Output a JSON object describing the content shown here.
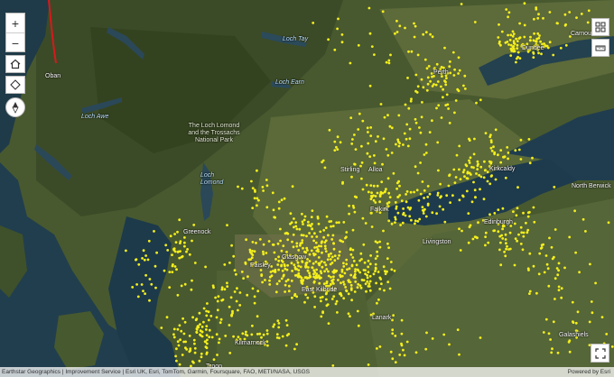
{
  "map": {
    "place_labels": [
      {
        "id": "oban",
        "text": "Oban"
      },
      {
        "id": "perth",
        "text": "Perth"
      },
      {
        "id": "dundee",
        "text": "Dundee"
      },
      {
        "id": "carnoustie",
        "text": "Carnous"
      },
      {
        "id": "kirkcaldy",
        "text": "Kirkcaldy"
      },
      {
        "id": "stirling",
        "text": "Stirling"
      },
      {
        "id": "alloa",
        "text": "Alloa"
      },
      {
        "id": "falkirk",
        "text": "Falkirk"
      },
      {
        "id": "north-berwick",
        "text": "North Berwick"
      },
      {
        "id": "edinburgh",
        "text": "Edinburgh"
      },
      {
        "id": "livingston",
        "text": "Livingston"
      },
      {
        "id": "greenock",
        "text": "Greenock"
      },
      {
        "id": "glasgow",
        "text": "Glasgow"
      },
      {
        "id": "paisley",
        "text": "Paisley"
      },
      {
        "id": "east-kilbride",
        "text": "East Kilbride"
      },
      {
        "id": "lanark",
        "text": "Lanark"
      },
      {
        "id": "kilmarnock",
        "text": "Kilmarnock"
      },
      {
        "id": "troon",
        "text": "Troon"
      },
      {
        "id": "galashiels",
        "text": "Galashiels"
      }
    ],
    "water_labels": [
      {
        "id": "loch-tay",
        "text": "Loch Tay"
      },
      {
        "id": "loch-earn",
        "text": "Loch Earn"
      },
      {
        "id": "loch-awe",
        "text": "Loch Awe"
      },
      {
        "id": "loch-lomond",
        "text": "Loch Lomond"
      }
    ],
    "park_label": "The Loch Lomond and the Trossachs National Park",
    "point_color": "#f5ef1c"
  },
  "controls": {
    "zoom_in": "+",
    "zoom_out": "−",
    "home_icon": "home-icon",
    "locate_icon": "locate-icon",
    "compass_icon": "compass-icon",
    "basemap_icon": "basemap-gallery-icon",
    "legend_icon": "legend-icon",
    "fullscreen_icon": "fullscreen-icon"
  },
  "attribution": {
    "left": "Earthstar Geographics | Improvement Service | Esri UK, Esri, TomTom, Garmin, Foursquare, FAO, METI/NASA, USGS",
    "right": "Powered by Esri"
  }
}
